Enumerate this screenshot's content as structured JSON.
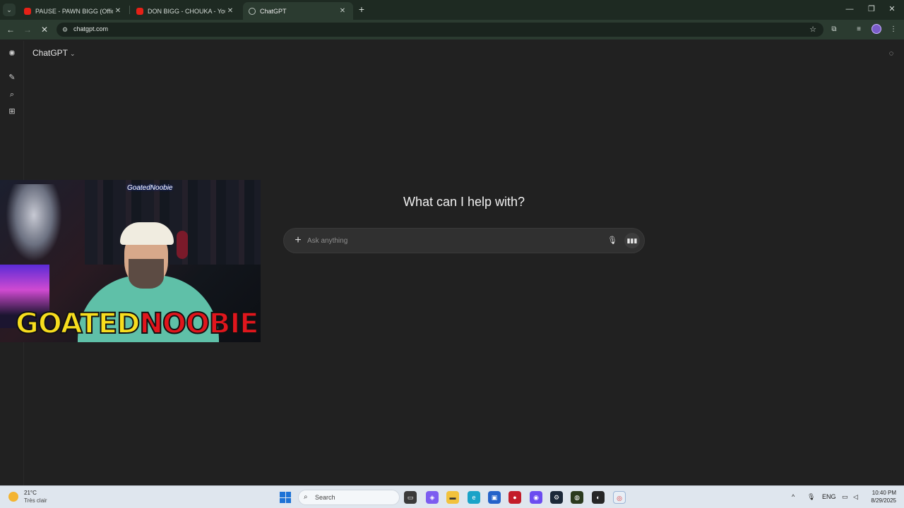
{
  "browser": {
    "tabs": [
      {
        "title": "PAUSE - PAWN BIGG (Official A",
        "favicon": "youtube-icon"
      },
      {
        "title": "DON BIGG - CHOUKA - YouTub",
        "favicon": "youtube-icon"
      },
      {
        "title": "ChatGPT",
        "favicon": "chatgpt-icon",
        "active": true
      }
    ],
    "new_tab": "+",
    "url": "chatgpt.com"
  },
  "app": {
    "model_label": "ChatGPT",
    "headline": "What can I help with?",
    "composer": {
      "placeholder": "Ask anything"
    }
  },
  "overlay": {
    "handle": "GoatedNoobie",
    "banner_left": "GOATED",
    "banner_right": "NOOBIE"
  },
  "taskbar": {
    "weather_temp": "21°C",
    "weather_desc": "Très clair",
    "search_placeholder": "Search",
    "language": "ENG",
    "time": "10:40 PM",
    "date": "8/29/2025"
  },
  "colors": {
    "app_bg": "#212121",
    "browser_chrome": "#2b3b30",
    "banner_yellow": "#f7dd1e",
    "banner_red": "#e0161d"
  }
}
